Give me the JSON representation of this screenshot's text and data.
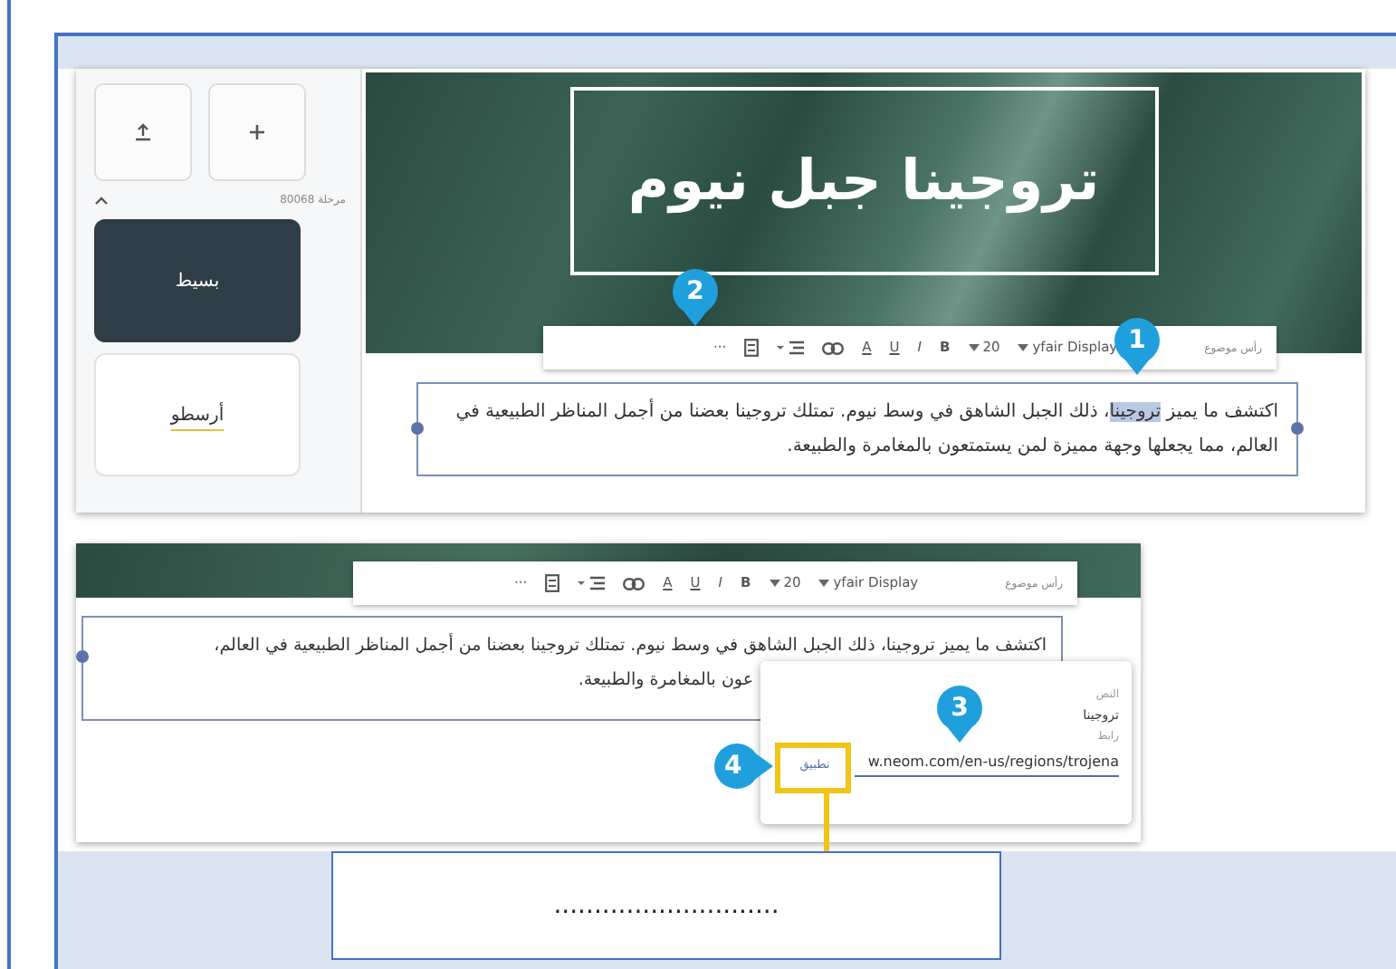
{
  "sidebar": {
    "buttons": [
      {
        "kind": "upload"
      },
      {
        "kind": "add"
      }
    ],
    "caption": "مرحلة 80068",
    "expanded": true,
    "themes": [
      {
        "label": "بسيط",
        "selected": true
      },
      {
        "label": "أرسطو",
        "selected": false
      }
    ]
  },
  "editor_1": {
    "title": "تروجينا جبل نيوم",
    "toolbar": {
      "style_label": "رأس موضوع",
      "font": "yfair Display",
      "size": "20",
      "buttons": [
        {
          "kind": "bold",
          "label": "B"
        },
        {
          "kind": "italic",
          "label": "I"
        },
        {
          "kind": "underline",
          "label": "U"
        },
        {
          "kind": "color",
          "label": "A"
        },
        {
          "kind": "link"
        },
        {
          "kind": "align"
        },
        {
          "kind": "list"
        },
        {
          "kind": "more",
          "label": "···"
        }
      ]
    },
    "paragraph": {
      "before": "اكتشف ما يميز ",
      "selected_word": "تروجينا",
      "after": "، ذلك الجبل الشاهق في وسط نيوم. تمتلك تروجينا بعضنا من أجمل المناظر الطبيعية في العالم، مما يجعلها وجهة مميزة لمن يستمتعون بالمغامرة والطبيعة."
    },
    "callouts": [
      "1",
      "2"
    ]
  },
  "editor_2": {
    "toolbar": {
      "style_label": "رأس موضوع",
      "font": "yfair Display",
      "size": "20",
      "buttons": [
        {
          "kind": "bold",
          "label": "B"
        },
        {
          "kind": "italic",
          "label": "I"
        },
        {
          "kind": "underline",
          "label": "U"
        },
        {
          "kind": "color",
          "label": "A"
        },
        {
          "kind": "link"
        },
        {
          "kind": "align"
        },
        {
          "kind": "list"
        },
        {
          "kind": "more",
          "label": "···"
        }
      ]
    },
    "paragraph_lines": [
      "اكتشف ما يميز تروجينا، ذلك الجبل الشاهق في وسط نيوم. تمتلك تروجينا بعضنا من أجمل المناظر الطبيعية في العالم،",
      "عون بالمغامرة والطبيعة."
    ],
    "link_popup": {
      "text_label": "النص",
      "text_value": "تروجينا",
      "link_label": "رابط",
      "link_value": "w.neom.com/en-us/regions/trojena",
      "apply": "تطبيق"
    },
    "callouts": [
      "3",
      "4"
    ]
  },
  "answer_line": "............................"
}
